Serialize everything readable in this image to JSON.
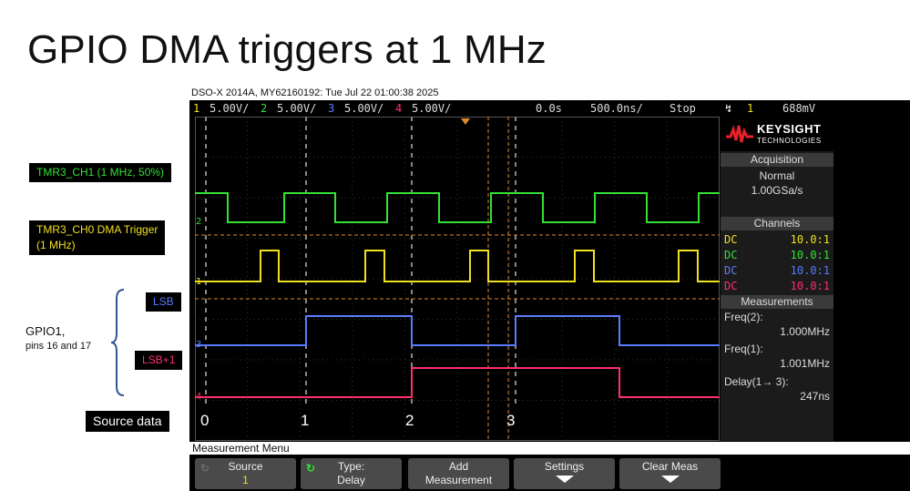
{
  "slide": {
    "title": "GPIO DMA triggers at 1 MHz"
  },
  "labels": {
    "ch1": {
      "text": "TMR3_CH1 (1 MHz, 50%)",
      "color": "#35e035"
    },
    "ch0_line1": {
      "text": "TMR3_CH0 DMA Trigger",
      "color": "#f0e020"
    },
    "ch0_line2": {
      "text": "(1 MHz)",
      "color": "#f0e020"
    },
    "lsb": {
      "text": "LSB",
      "color": "#5a7cff"
    },
    "lsb1": {
      "text": "LSB+1",
      "color": "#ff2f6e"
    },
    "gpio_line1": "GPIO1,",
    "gpio_line2": "pins 16 and 17",
    "source_data": "Source data"
  },
  "scope": {
    "header": "DSO-X 2014A, MY62160192: Tue Jul 22 01:00:38 2025",
    "channels_bar": {
      "ch1_num": "1",
      "ch1_scale": "5.00V/",
      "ch2_num": "2",
      "ch2_scale": "5.00V/",
      "ch3_num": "3",
      "ch3_scale": "5.00V/",
      "ch4_num": "4",
      "ch4_scale": "5.00V/",
      "time_pos": "0.0s",
      "time_scale": "500.0ns/",
      "run_state": "Stop",
      "trig_ch": "1",
      "trig_level": "688mV"
    },
    "colors": {
      "ch1": "#f0e020",
      "ch2": "#35e035",
      "ch3": "#5a7cff",
      "ch4": "#ff2f6e",
      "cursor": "#e08a2c"
    },
    "brand": {
      "name": "KEYSIGHT",
      "sub": "TECHNOLOGIES"
    },
    "acquisition": {
      "title": "Acquisition",
      "mode": "Normal",
      "rate": "1.00GSa/s"
    },
    "channels_panel": {
      "title": "Channels",
      "rows": [
        {
          "coupling": "DC",
          "ratio": "10.0:1"
        },
        {
          "coupling": "DC",
          "ratio": "10.0:1"
        },
        {
          "coupling": "DC",
          "ratio": "10.0:1"
        },
        {
          "coupling": "DC",
          "ratio": "10.0:1"
        }
      ]
    },
    "measurements": {
      "title": "Measurements",
      "freq2_label": "Freq(2):",
      "freq2_value": "1.000MHz",
      "freq1_label": "Freq(1):",
      "freq1_value": "1.001MHz",
      "delay_label": "Delay(1→ 3):",
      "delay_value": "247ns"
    },
    "edge_numbers": [
      "0",
      "1",
      "2",
      "3"
    ],
    "menu_title": "Measurement Menu",
    "softkeys": [
      {
        "line1": "Source",
        "line2": "1"
      },
      {
        "line1": "Type:",
        "line2": "Delay"
      },
      {
        "line1": "Add",
        "line2": "Measurement"
      },
      {
        "line1": "Settings",
        "line2": ""
      },
      {
        "line1": "Clear Meas",
        "line2": ""
      }
    ]
  }
}
